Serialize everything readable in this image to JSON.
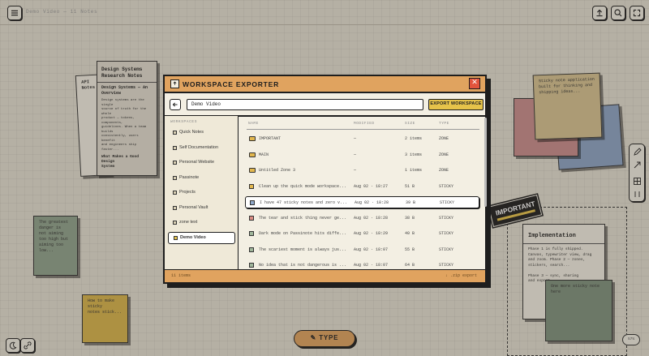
{
  "topbar": {
    "title": "Demo Video — 11 Notes"
  },
  "background_notes": {
    "api_note": {
      "title": "API Notes"
    },
    "design_note": {
      "title": "Design Systems\nResearch Notes",
      "subtitle": "Design Systems — An\nOverview",
      "body": "Design systems are the single\nsource of truth for the whole\nproduct — tokens, components,\nguidelines. When a team builds\nconsistently, users benefit\nand engineers ship faster...",
      "footer": "What Makes a Good Design\nSystem"
    },
    "green_note": {
      "text": "The greatest danger is\nnot aiming too high but\naiming too low..."
    },
    "yellow_note": {
      "text": "How to make sticky\nnotes stick..."
    },
    "tan_note": {
      "text": "Sticky note application\nbuilt for thinking and\nshipping ideas..."
    },
    "implementation": {
      "title": "Implementation",
      "body": "Phase 1 is fully shipped.\nCanvas, typewriter view, drag\nand zoom. Phase 2 — zones,\nstickers, search...\n\nPhase 3 — sync, sharing\nand export..."
    },
    "dark_green_note": {
      "text": "One more sticky note here"
    },
    "tag": {
      "label": "IMPORTANT"
    }
  },
  "type_button": {
    "label": "TYPE"
  },
  "zoom": "57%",
  "modal": {
    "title": "WORKSPACE EXPORTER",
    "project_name": "Demo Video",
    "export_label": "EXPORT WORKSPACE",
    "sidebar_label": "WORKSPACES",
    "workspaces": [
      {
        "label": "Quick Notes"
      },
      {
        "label": "Self Documentation"
      },
      {
        "label": "Personal Website"
      },
      {
        "label": "Passinote"
      },
      {
        "label": "Projects"
      },
      {
        "label": "Personal Vault"
      },
      {
        "label": "zone text"
      },
      {
        "label": "Demo Video",
        "active": true
      }
    ],
    "columns": {
      "name": "NAME",
      "modified": "MODIFIED",
      "size": "SIZE",
      "type": "TYPE"
    },
    "rows": [
      {
        "name": "IMPORTANT",
        "modified": "—",
        "size": "2 items",
        "type": "ZONE",
        "kind": "folder",
        "color": "#e2b74e"
      },
      {
        "name": "MAIN",
        "modified": "—",
        "size": "3 items",
        "type": "ZONE",
        "kind": "folder",
        "color": "#e2b74e"
      },
      {
        "name": "Untitled Zone 3",
        "modified": "—",
        "size": "1 items",
        "type": "ZONE",
        "kind": "folder",
        "color": "#e2b74e"
      },
      {
        "name": "Clean up the quick mode workspace...",
        "modified": "Aug 02 · 18:27",
        "size": "51 B",
        "type": "STICKY",
        "kind": "sticky",
        "color": "#e2b74e"
      },
      {
        "name": "I have 47 sticky notes and zero v...",
        "modified": "Aug 02 · 18:28",
        "size": "39 B",
        "type": "STICKY",
        "kind": "sticky",
        "color": "#8fa8c9",
        "highlight": true
      },
      {
        "name": "The tear and stick thing never ge...",
        "modified": "Aug 02 · 18:28",
        "size": "38 B",
        "type": "STICKY",
        "kind": "sticky",
        "color": "#d98c83"
      },
      {
        "name": "Dark mode on Passinote hits diffe...",
        "modified": "Aug 02 · 18:29",
        "size": "40 B",
        "type": "STICKY",
        "kind": "sticky",
        "color": "#9fb59a"
      },
      {
        "name": "The scariest moment is always jus...",
        "modified": "Aug 02 · 18:07",
        "size": "55 B",
        "type": "STICKY",
        "kind": "sticky",
        "color": "#9fb59a"
      },
      {
        "name": "No idea that is not dangerous is ...",
        "modified": "Aug 02 · 18:07",
        "size": "64 B",
        "type": "STICKY",
        "kind": "sticky",
        "color": "#9fb59a"
      }
    ],
    "footer_left": "11 items",
    "footer_right": "↓ .zip export"
  }
}
